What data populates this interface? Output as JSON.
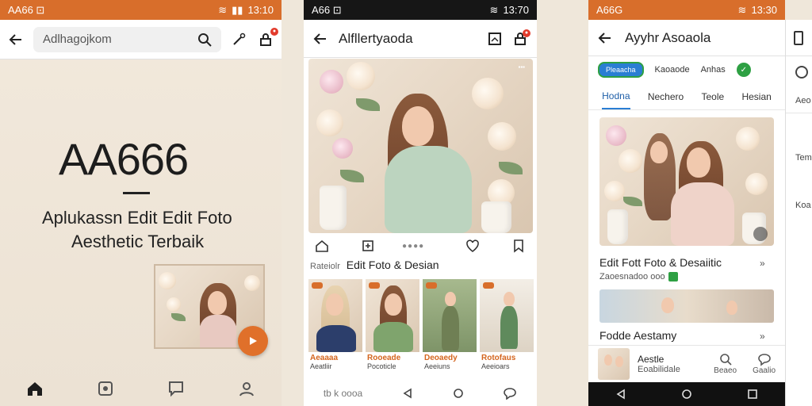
{
  "panel1": {
    "status": {
      "left": "AA66 ⊡",
      "time": "13:10"
    },
    "search_text": "Adlhagojkom",
    "headline": "AA666",
    "subtitle_line1": "Aplukassn Edit Edit Foto",
    "subtitle_line2": "Aesthetic Terbaik",
    "bottom_nav": [
      "home-icon",
      "gallery-icon",
      "chat-icon",
      "profile-icon"
    ]
  },
  "panel2": {
    "status": {
      "left": "A66 ⊡",
      "time": "13:70"
    },
    "title": "Alfllertyaoda",
    "image_tag": "▪▪▪",
    "section_label_prefix": "Rateiolr",
    "section_label": "Edit Foto & Desian",
    "cards": [
      {
        "tag": "",
        "title": "Aeaaaa",
        "sub": "Aeatliir"
      },
      {
        "tag": "",
        "title": "Rooeade",
        "sub": "Pocoticle"
      },
      {
        "tag": "",
        "title": "Deoaedy",
        "sub": "Aeeiuns"
      },
      {
        "tag": "",
        "title": "Rotofaus",
        "sub": "Aeeioars"
      }
    ],
    "bottom_text": "tb k oooa"
  },
  "panel3": {
    "status": {
      "left": "A66G",
      "time": "13:30"
    },
    "title": "Ayyhr Asoaola",
    "chips": [
      "Pleaacha",
      "Kaoaode",
      "Anhas"
    ],
    "tabs": [
      "Hodna",
      "Nechero",
      "Teole",
      "Hesian"
    ],
    "card1_title": "Edit Fott Foto & Desaiitic",
    "card1_sub": "Zaoesnadoo ooo",
    "card2_title": "Fodde Aestamy",
    "list_title": "Aestle",
    "list_sub": "Eoabilidale",
    "list_btn1": "Beaeo",
    "list_btn2": "Gaalio"
  },
  "panel4": {
    "labels": [
      "Aeo",
      "Tem",
      "Koa"
    ]
  },
  "colors": {
    "accent": "#d86e2b",
    "blue": "#2a7ed3",
    "green": "#2ea043"
  }
}
